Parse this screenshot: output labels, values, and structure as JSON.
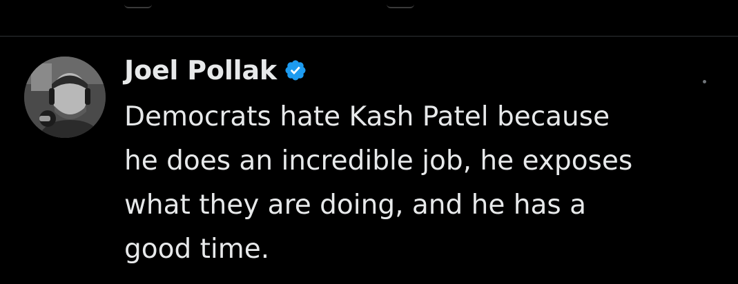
{
  "tweet": {
    "author": {
      "display_name": "Joel Pollak",
      "verified": true,
      "avatar_icon": "profile-photo"
    },
    "text": "Democrats hate Kash Patel because\nhe does an incredible job, he exposes\nwhat they are doing, and he has a\ngood time."
  },
  "colors": {
    "background": "#000000",
    "text": "#e7e9ea",
    "verified_badge": "#1d9bf0",
    "divider": "#2f3336",
    "muted": "#71767b"
  }
}
